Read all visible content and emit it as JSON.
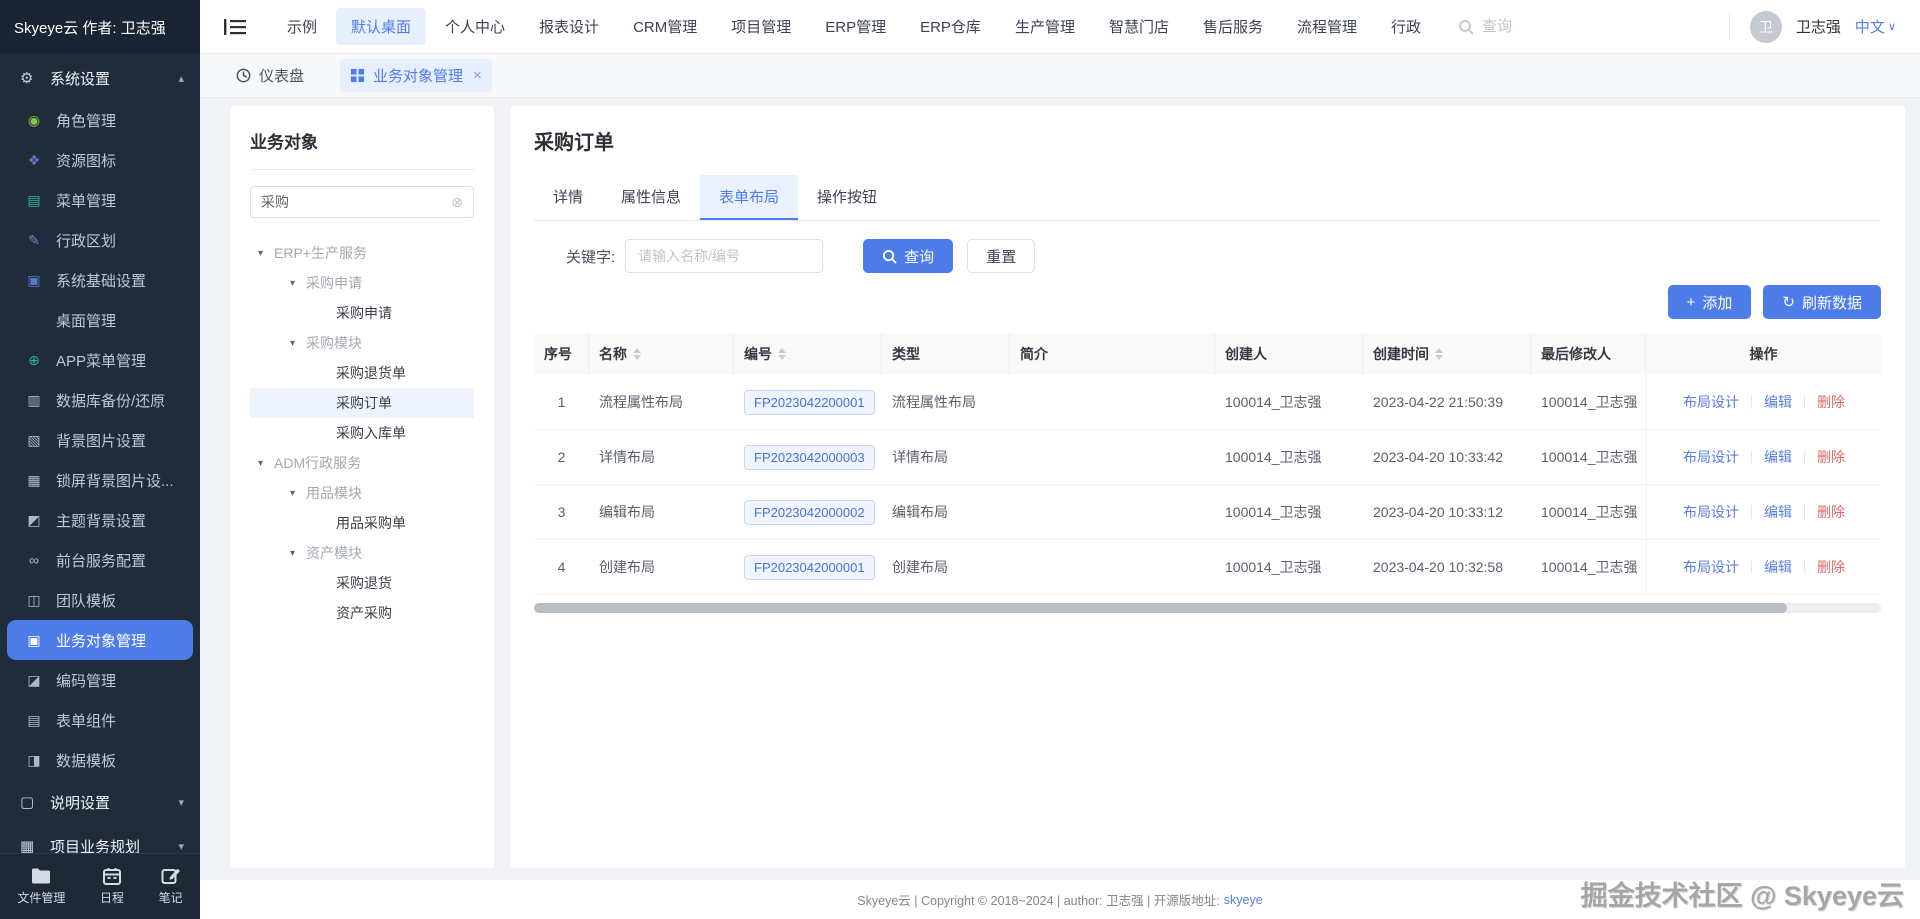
{
  "colors": {
    "accent": "#4e7ce8",
    "danger": "#dd6b66",
    "sidebar_bg": "#212c3b",
    "tag_text": "#4a6fdc",
    "tag_bg": "#f0f4ff"
  },
  "brand": {
    "logo_text": "Skyeye云 作者: 卫志强"
  },
  "topnav": {
    "items": [
      {
        "label": "示例"
      },
      {
        "label": "默认桌面"
      },
      {
        "label": "个人中心"
      },
      {
        "label": "报表设计"
      },
      {
        "label": "CRM管理"
      },
      {
        "label": "项目管理"
      },
      {
        "label": "ERP管理"
      },
      {
        "label": "ERP仓库"
      },
      {
        "label": "生产管理"
      },
      {
        "label": "智慧门店"
      },
      {
        "label": "售后服务"
      },
      {
        "label": "流程管理"
      },
      {
        "label": "行政"
      }
    ],
    "search_placeholder": "查询",
    "user": {
      "avatar_char": "卫",
      "name": "卫志强",
      "lang": "中文",
      "lang_caret": "∨"
    }
  },
  "sidebar": {
    "section": {
      "label": "系统设置",
      "glyph": "⚙",
      "caret": "▴"
    },
    "items": [
      {
        "label": "角色管理",
        "glyph": "◉"
      },
      {
        "label": "资源图标",
        "glyph": "❖"
      },
      {
        "label": "菜单管理",
        "glyph": "▤"
      },
      {
        "label": "行政区划",
        "glyph": "✎"
      },
      {
        "label": "系统基础设置",
        "glyph": "▣"
      },
      {
        "label": "桌面管理",
        "glyph": ""
      },
      {
        "label": "APP菜单管理",
        "glyph": "⊕"
      },
      {
        "label": "数据库备份/还原",
        "glyph": "▥"
      },
      {
        "label": "背景图片设置",
        "glyph": "▧"
      },
      {
        "label": "锁屏背景图片设...",
        "glyph": "▦"
      },
      {
        "label": "主题背景设置",
        "glyph": "◩"
      },
      {
        "label": "前台服务配置",
        "glyph": "∞"
      },
      {
        "label": "团队模板",
        "glyph": "◫"
      },
      {
        "label": "业务对象管理",
        "glyph": "▣"
      },
      {
        "label": "编码管理",
        "glyph": "◪"
      },
      {
        "label": "表单组件",
        "glyph": "▤"
      },
      {
        "label": "数据模板",
        "glyph": "◨"
      }
    ],
    "collapsed": [
      {
        "label": "说明设置",
        "glyph": "▢",
        "caret": "▾"
      },
      {
        "label": "项目业务规划",
        "glyph": "▦",
        "caret": "▾"
      }
    ],
    "footer_items": [
      {
        "label": "文件管理"
      },
      {
        "label": "日程"
      },
      {
        "label": "笔记"
      }
    ]
  },
  "tabbar": {
    "tabs": [
      {
        "label": "仪表盘"
      },
      {
        "label": "业务对象管理",
        "close": "×"
      }
    ]
  },
  "left_panel": {
    "title": "业务对象",
    "search_value": "采购",
    "clear_glyph": "⊗",
    "tree": [
      {
        "label": "ERP+生产服务"
      },
      {
        "label": "采购申请"
      },
      {
        "label": "采购申请"
      },
      {
        "label": "采购模块"
      },
      {
        "label": "采购退货单"
      },
      {
        "label": "采购订单"
      },
      {
        "label": "采购入库单"
      },
      {
        "label": "ADM行政服务"
      },
      {
        "label": "用品模块"
      },
      {
        "label": "用品采购单"
      },
      {
        "label": "资产模块"
      },
      {
        "label": "采购退货"
      },
      {
        "label": "资产采购"
      }
    ],
    "caret": "▾"
  },
  "main": {
    "title": "采购订单",
    "tabs": [
      {
        "label": "详情"
      },
      {
        "label": "属性信息"
      },
      {
        "label": "表单布局"
      },
      {
        "label": "操作按钮"
      }
    ],
    "filter": {
      "label": "关键字:",
      "placeholder": "请输入名称/编号",
      "search_label": "查询",
      "reset_label": "重置"
    },
    "actions": {
      "add_label": "添加",
      "add_glyph": "+",
      "refresh_label": "刷新数据",
      "refresh_glyph": "↻"
    },
    "table": {
      "columns": [
        {
          "label": "序号"
        },
        {
          "label": "名称"
        },
        {
          "label": "编号"
        },
        {
          "label": "类型"
        },
        {
          "label": "简介"
        },
        {
          "label": "创建人"
        },
        {
          "label": "创建时间"
        },
        {
          "label": "最后修改人"
        },
        {
          "label": "操作"
        }
      ],
      "rows": [
        {
          "idx": "1",
          "name": "流程属性布局",
          "code": "FP2023042200001",
          "type": "流程属性布局",
          "desc": "",
          "creator": "100014_卫志强",
          "ctime": "2023-04-22 21:50:39",
          "modifier": "100014_卫志强"
        },
        {
          "idx": "2",
          "name": "详情布局",
          "code": "FP2023042000003",
          "type": "详情布局",
          "desc": "",
          "creator": "100014_卫志强",
          "ctime": "2023-04-20 10:33:42",
          "modifier": "100014_卫志强"
        },
        {
          "idx": "3",
          "name": "编辑布局",
          "code": "FP2023042000002",
          "type": "编辑布局",
          "desc": "",
          "creator": "100014_卫志强",
          "ctime": "2023-04-20 10:33:12",
          "modifier": "100014_卫志强"
        },
        {
          "idx": "4",
          "name": "创建布局",
          "code": "FP2023042000001",
          "type": "创建布局",
          "desc": "",
          "creator": "100014_卫志强",
          "ctime": "2023-04-20 10:32:58",
          "modifier": "100014_卫志强"
        }
      ],
      "row_actions": {
        "design": "布局设计",
        "edit": "编辑",
        "delete": "删除"
      }
    }
  },
  "footer": {
    "text": "Skyeye云 | Copyright © 2018~2024 | author:  卫志强 | 开源版地址:",
    "link": "skyeye"
  },
  "watermark": "掘金技术社区 @ Skyeye云"
}
